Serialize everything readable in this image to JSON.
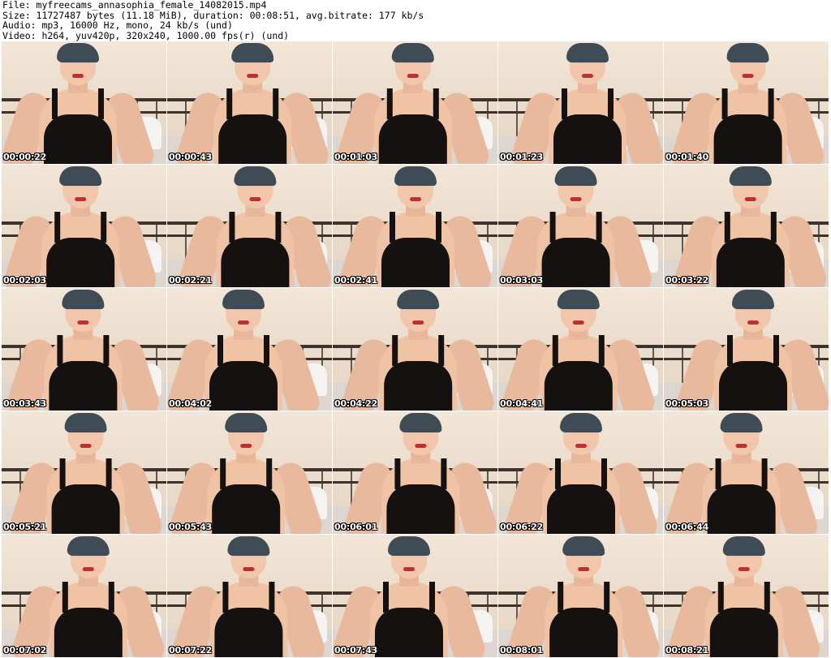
{
  "header": {
    "file": "File: myfreecams_annasophia_female_14082015.mp4",
    "size": "Size: 11727487 bytes (11.18 MiB), duration: 00:08:51, avg.bitrate: 177 kb/s",
    "audio": "Audio: mp3, 16000 Hz, mono, 24 kb/s (und)",
    "video": "Video: h264, yuv420p, 320x240, 1000.00 fps(r) (und)"
  },
  "thumbnails": [
    {
      "timestamp": "00:00:22"
    },
    {
      "timestamp": "00:00:43"
    },
    {
      "timestamp": "00:01:03"
    },
    {
      "timestamp": "00:01:23"
    },
    {
      "timestamp": "00:01:40"
    },
    {
      "timestamp": "00:02:03"
    },
    {
      "timestamp": "00:02:21"
    },
    {
      "timestamp": "00:02:41"
    },
    {
      "timestamp": "00:03:03"
    },
    {
      "timestamp": "00:03:22"
    },
    {
      "timestamp": "00:03:43"
    },
    {
      "timestamp": "00:04:02"
    },
    {
      "timestamp": "00:04:22"
    },
    {
      "timestamp": "00:04:41"
    },
    {
      "timestamp": "00:05:03"
    },
    {
      "timestamp": "00:05:21"
    },
    {
      "timestamp": "00:05:43"
    },
    {
      "timestamp": "00:06:01"
    },
    {
      "timestamp": "00:06:22"
    },
    {
      "timestamp": "00:06:44"
    },
    {
      "timestamp": "00:07:02"
    },
    {
      "timestamp": "00:07:22"
    },
    {
      "timestamp": "00:07:43"
    },
    {
      "timestamp": "00:08:01"
    },
    {
      "timestamp": "00:08:21"
    }
  ]
}
